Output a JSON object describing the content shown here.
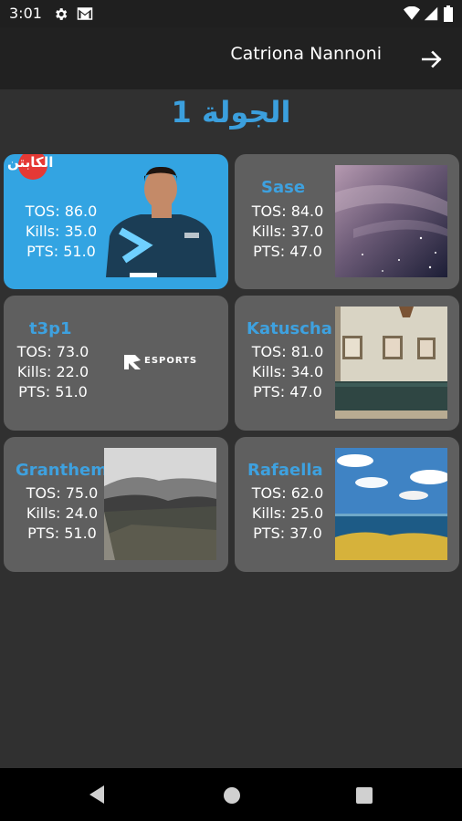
{
  "status_bar": {
    "time": "3:01"
  },
  "app_bar": {
    "user_name": "Catriona Nannoni"
  },
  "page": {
    "round_title": "الجولة 1"
  },
  "players": [
    {
      "name": "",
      "tos": "TOS: 86.0",
      "kills": "Kills: 35.0",
      "pts": "PTS: 51.0",
      "badge": "الكابتن",
      "image": "player-photo"
    },
    {
      "name": "Sase",
      "tos": "TOS: 84.0",
      "kills": "Kills: 37.0",
      "pts": "PTS: 47.0",
      "image": "night-sky-photo"
    },
    {
      "name": "t3p1",
      "tos": "TOS: 73.0",
      "kills": "Kills: 22.0",
      "pts": "PTS: 51.0",
      "logo_text": "ESPORTS"
    },
    {
      "name": "Katuscha",
      "tos": "TOS: 81.0",
      "kills": "Kills: 34.0",
      "pts": "PTS: 47.0",
      "image": "room-interior-photo"
    },
    {
      "name": "Granthem",
      "tos": "TOS: 75.0",
      "kills": "Kills: 24.0",
      "pts": "PTS: 51.0",
      "image": "mountain-photo"
    },
    {
      "name": "Rafaella",
      "tos": "TOS: 62.0",
      "kills": "Kills: 25.0",
      "pts": "PTS: 37.0",
      "image": "sea-photo"
    }
  ],
  "colors": {
    "accent": "#3b9fdd",
    "card_bg": "#5f5f5f",
    "active_card_bg": "#33a4e2",
    "captain_badge": "#e53935"
  }
}
